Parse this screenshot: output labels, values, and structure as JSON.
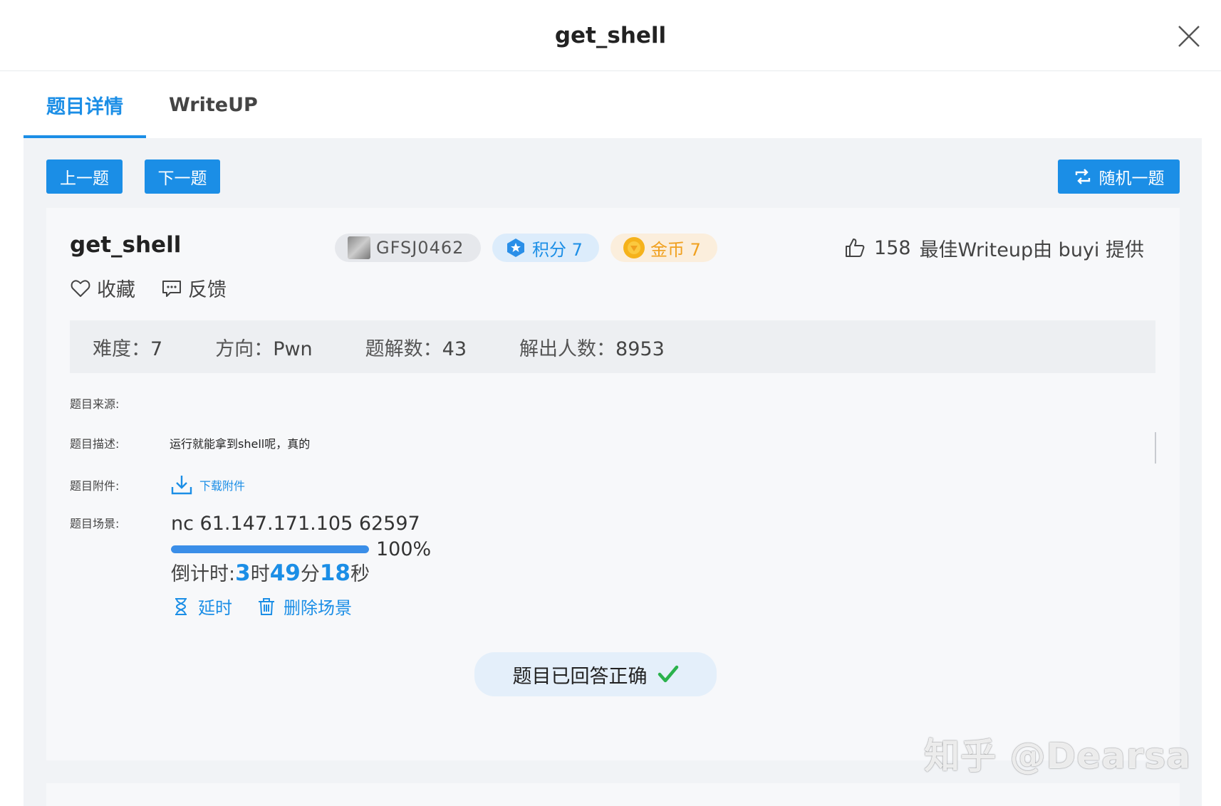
{
  "modal": {
    "title": "get_shell"
  },
  "tabs": [
    {
      "label": "题目详情",
      "active": true
    },
    {
      "label": "WriteUP",
      "active": false
    }
  ],
  "nav": {
    "prev_label": "上一题",
    "next_label": "下一题",
    "random_label": "随机一题"
  },
  "question": {
    "title": "get_shell",
    "id": "GFSJ0462",
    "score_label": "积分 7",
    "coin_label": "金币 7",
    "likes": "158",
    "best_writeup": "最佳Writeup由 buyi 提供",
    "favorite_label": "收藏",
    "feedback_label": "反馈"
  },
  "stats": {
    "difficulty_label": "难度：",
    "difficulty": "7",
    "direction_label": "方向：",
    "direction": "Pwn",
    "writeups_label": "题解数：",
    "writeups": "43",
    "solvers_label": "解出人数：",
    "solvers": "8953"
  },
  "details": {
    "source_label": "题目来源:",
    "source": "",
    "desc_label": "题目描述:",
    "desc": "运行就能拿到shell呢，真的",
    "attachment_label": "题目附件:",
    "attachment_link": "下载附件",
    "scene_label": "题目场景:",
    "scene_cmd": "nc 61.147.171.105 62597",
    "progress_percent": 100,
    "progress_text": "100%",
    "countdown_label": "倒计时: ",
    "countdown_h": "3",
    "countdown_h_unit": "时",
    "countdown_m": "49",
    "countdown_m_unit": "分",
    "countdown_s": "18",
    "countdown_s_unit": "秒",
    "extend_label": "延时",
    "delete_label": "删除场景"
  },
  "status": {
    "answered_label": "题目已回答正确"
  },
  "watermark": "知乎 @Dearsa",
  "colors": {
    "accent": "#1b8ee6",
    "coin": "#f0a01e",
    "success": "#2bb24c"
  }
}
